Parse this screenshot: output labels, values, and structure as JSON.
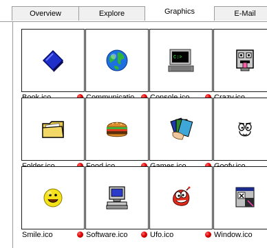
{
  "tabs": [
    {
      "label": "Overview",
      "active": false
    },
    {
      "label": "Explore",
      "active": false
    },
    {
      "label": "Graphics",
      "active": true
    },
    {
      "label": "E-Mail",
      "active": false
    }
  ],
  "icons": [
    {
      "label": "Book.ico",
      "icon": "book-icon"
    },
    {
      "label": "Communicatio",
      "icon": "globe-icon"
    },
    {
      "label": "Console.ico",
      "icon": "console-icon"
    },
    {
      "label": "Crazy.ico",
      "icon": "crazy-face-icon"
    },
    {
      "label": "Folder.ico",
      "icon": "folder-icon"
    },
    {
      "label": "Food.ico",
      "icon": "burger-icon"
    },
    {
      "label": "Games.ico",
      "icon": "playing-cards-icon"
    },
    {
      "label": "Goofy.ico",
      "icon": "goofy-face-icon"
    },
    {
      "label": "Smile.ico",
      "icon": "smiley-icon"
    },
    {
      "label": "Software.ico",
      "icon": "computer-icon"
    },
    {
      "label": "Ufo.ico",
      "icon": "ufo-creature-icon"
    },
    {
      "label": "Window.ico",
      "icon": "window-icon"
    }
  ],
  "status_dot_color": "#e00000"
}
